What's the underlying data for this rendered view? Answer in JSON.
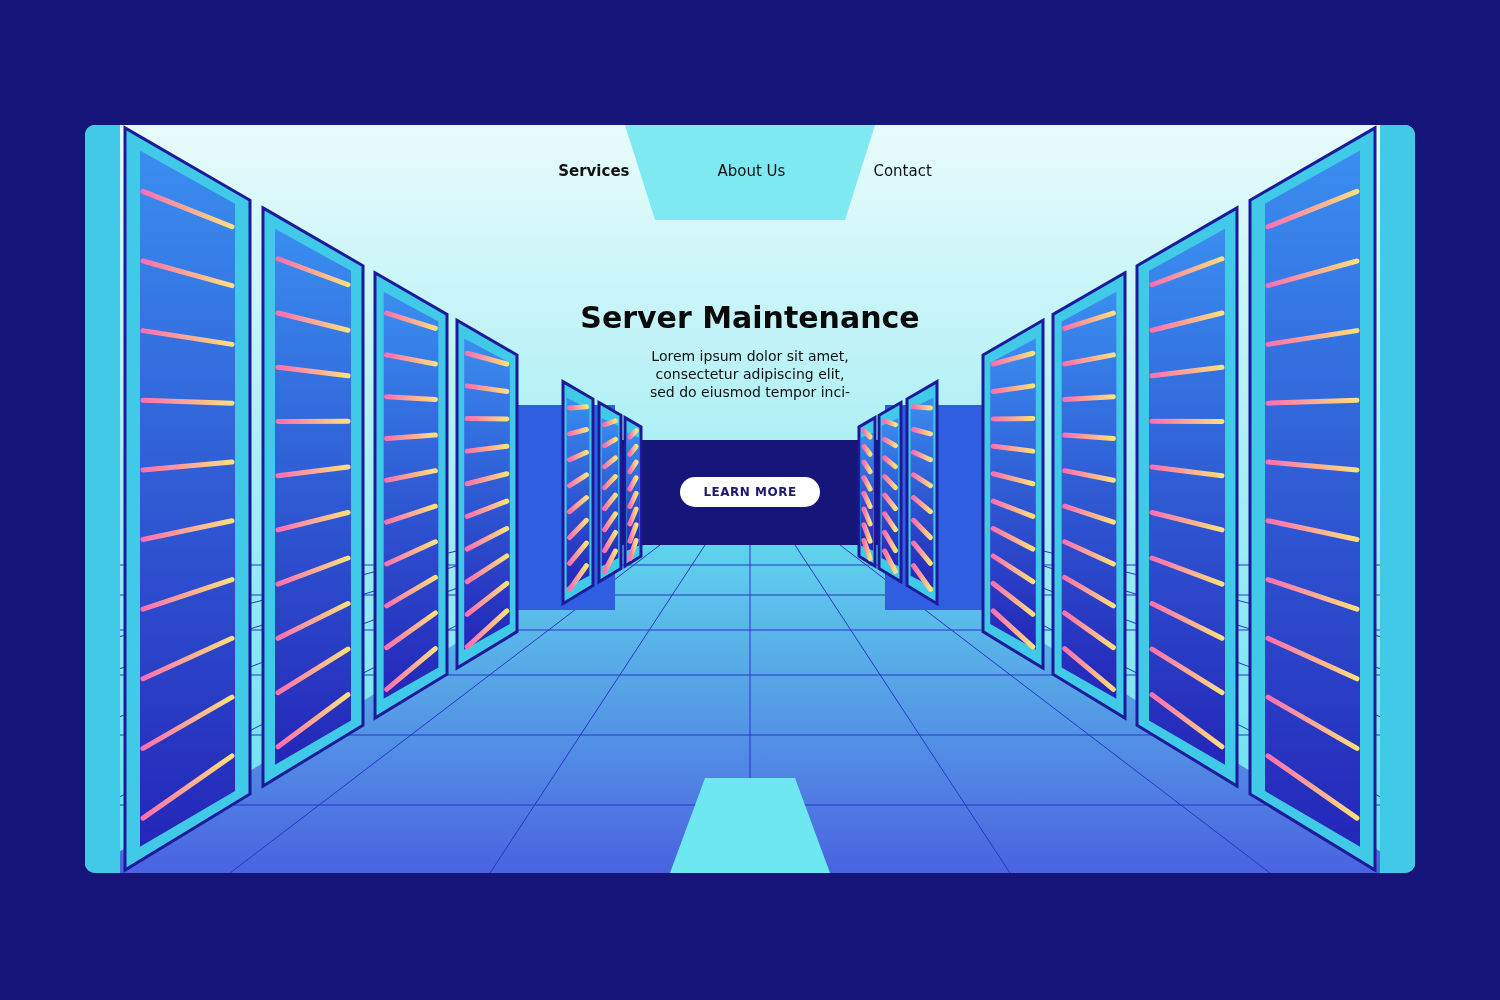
{
  "nav": [
    {
      "label": "Services",
      "selected": true
    },
    {
      "label": "About Us",
      "selected": false
    },
    {
      "label": "Contact",
      "selected": false
    }
  ],
  "hero": {
    "title": "Server Maintenance",
    "text": "Lorem ipsum dolor sit amet,\nconsectetur adipiscing elit,\nsed do eiusmod tempor inci-",
    "button": "LEARN MORE"
  }
}
